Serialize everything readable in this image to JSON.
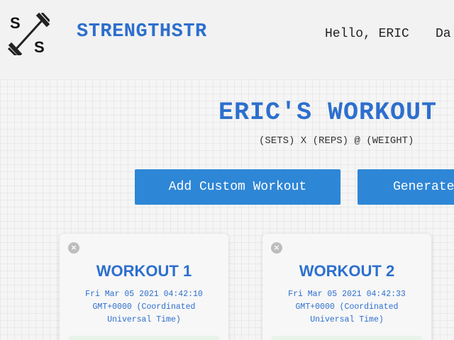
{
  "header": {
    "logo_top": "S",
    "logo_bottom": "S",
    "brand": "STRENGTHSTR",
    "greeting": "Hello, ERIC",
    "nav_partial": "Da"
  },
  "main": {
    "title": "ERIC'S WORKOUT",
    "subtitle": "(SETS) X (REPS) @ (WEIGHT)",
    "buttons": {
      "add": "Add Custom Workout",
      "generate": "Generate"
    },
    "cards": [
      {
        "close": "×",
        "title": "WORKOUT 1",
        "date_line1": "Fri Mar 05 2021 04:42:10",
        "date_line2": "GMT+0000 (Coordinated",
        "date_line3": "Universal Time)"
      },
      {
        "close": "×",
        "title": "WORKOUT 2",
        "date_line1": "Fri Mar 05 2021 04:42:33",
        "date_line2": "GMT+0000 (Coordinated",
        "date_line3": "Universal Time)"
      }
    ]
  },
  "colors": {
    "brand_blue": "#2d6fce",
    "button_blue": "#2e86d6",
    "background": "#f2f2f2"
  }
}
